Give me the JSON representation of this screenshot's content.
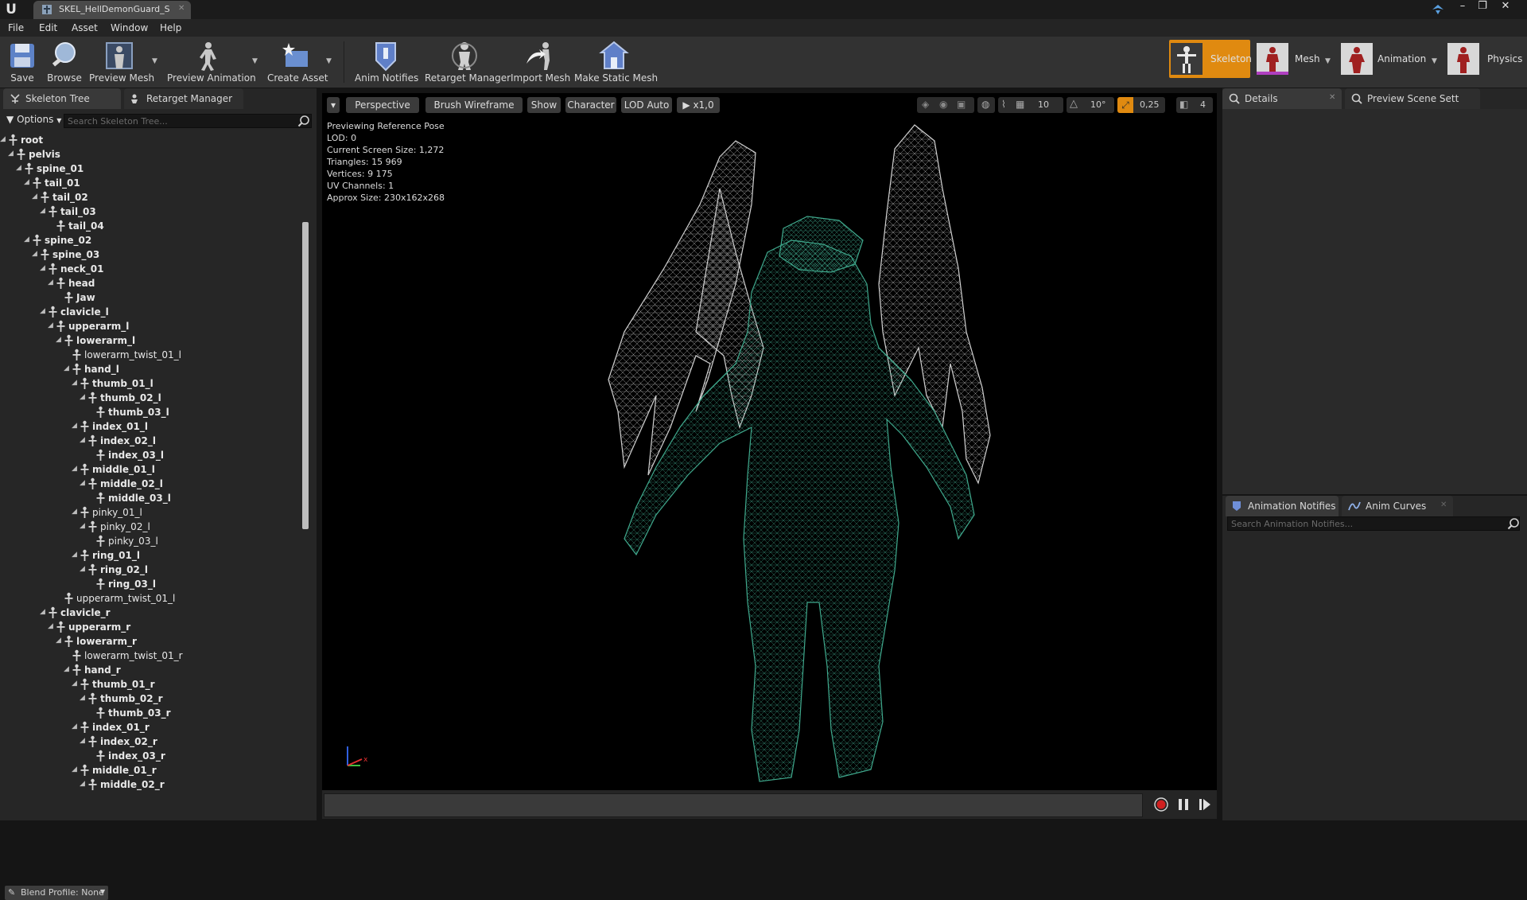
{
  "window": {
    "tab_title": "SKEL_HellDemonGuard_S",
    "minimize": "–",
    "restore": "❐",
    "close": "✕"
  },
  "menu": [
    "File",
    "Edit",
    "Asset",
    "Window",
    "Help"
  ],
  "toolbar": {
    "save": "Save",
    "browse": "Browse",
    "preview_mesh": "Preview Mesh",
    "preview_animation": "Preview Animation",
    "create_asset": "Create Asset",
    "anim_notifies": "Anim Notifies",
    "retarget_manager": "Retarget Manager",
    "import_mesh": "Import Mesh",
    "make_static_mesh": "Make Static Mesh"
  },
  "modes": {
    "skeleton": "Skeleton",
    "mesh": "Mesh",
    "animation": "Animation",
    "physics": "Physics",
    "active": "skeleton",
    "accent_color": "#e08a10"
  },
  "left_panel": {
    "tab_skeleton_tree": "Skeleton Tree",
    "tab_retarget_manager": "Retarget Manager",
    "options": "Options",
    "search_placeholder": "Search Skeleton Tree...",
    "blend_profile": "Blend Profile: None"
  },
  "bones": [
    {
      "name": "root",
      "depth": 0,
      "expanded": true,
      "weighted": true
    },
    {
      "name": "pelvis",
      "depth": 1,
      "expanded": true,
      "weighted": true
    },
    {
      "name": "spine_01",
      "depth": 2,
      "expanded": true,
      "weighted": true
    },
    {
      "name": "tail_01",
      "depth": 3,
      "expanded": true,
      "weighted": true
    },
    {
      "name": "tail_02",
      "depth": 4,
      "expanded": true,
      "weighted": true
    },
    {
      "name": "tail_03",
      "depth": 5,
      "expanded": true,
      "weighted": true
    },
    {
      "name": "tail_04",
      "depth": 6,
      "expanded": false,
      "weighted": true
    },
    {
      "name": "spine_02",
      "depth": 3,
      "expanded": true,
      "weighted": true
    },
    {
      "name": "spine_03",
      "depth": 4,
      "expanded": true,
      "weighted": true
    },
    {
      "name": "neck_01",
      "depth": 5,
      "expanded": true,
      "weighted": true
    },
    {
      "name": "head",
      "depth": 6,
      "expanded": true,
      "weighted": true
    },
    {
      "name": "Jaw",
      "depth": 7,
      "expanded": false,
      "weighted": true
    },
    {
      "name": "clavicle_l",
      "depth": 5,
      "expanded": true,
      "weighted": true
    },
    {
      "name": "upperarm_l",
      "depth": 6,
      "expanded": true,
      "weighted": true
    },
    {
      "name": "lowerarm_l",
      "depth": 7,
      "expanded": true,
      "weighted": true
    },
    {
      "name": "lowerarm_twist_01_l",
      "depth": 8,
      "expanded": false,
      "weighted": false
    },
    {
      "name": "hand_l",
      "depth": 8,
      "expanded": true,
      "weighted": true
    },
    {
      "name": "thumb_01_l",
      "depth": 9,
      "expanded": true,
      "weighted": true
    },
    {
      "name": "thumb_02_l",
      "depth": 10,
      "expanded": true,
      "weighted": true
    },
    {
      "name": "thumb_03_l",
      "depth": 11,
      "expanded": false,
      "weighted": true
    },
    {
      "name": "index_01_l",
      "depth": 9,
      "expanded": true,
      "weighted": true
    },
    {
      "name": "index_02_l",
      "depth": 10,
      "expanded": true,
      "weighted": true
    },
    {
      "name": "index_03_l",
      "depth": 11,
      "expanded": false,
      "weighted": true
    },
    {
      "name": "middle_01_l",
      "depth": 9,
      "expanded": true,
      "weighted": true
    },
    {
      "name": "middle_02_l",
      "depth": 10,
      "expanded": true,
      "weighted": true
    },
    {
      "name": "middle_03_l",
      "depth": 11,
      "expanded": false,
      "weighted": true
    },
    {
      "name": "pinky_01_l",
      "depth": 9,
      "expanded": true,
      "weighted": false
    },
    {
      "name": "pinky_02_l",
      "depth": 10,
      "expanded": true,
      "weighted": false
    },
    {
      "name": "pinky_03_l",
      "depth": 11,
      "expanded": false,
      "weighted": false
    },
    {
      "name": "ring_01_l",
      "depth": 9,
      "expanded": true,
      "weighted": true
    },
    {
      "name": "ring_02_l",
      "depth": 10,
      "expanded": true,
      "weighted": true
    },
    {
      "name": "ring_03_l",
      "depth": 11,
      "expanded": false,
      "weighted": true
    },
    {
      "name": "upperarm_twist_01_l",
      "depth": 7,
      "expanded": false,
      "weighted": false
    },
    {
      "name": "clavicle_r",
      "depth": 5,
      "expanded": true,
      "weighted": true
    },
    {
      "name": "upperarm_r",
      "depth": 6,
      "expanded": true,
      "weighted": true
    },
    {
      "name": "lowerarm_r",
      "depth": 7,
      "expanded": true,
      "weighted": true
    },
    {
      "name": "lowerarm_twist_01_r",
      "depth": 8,
      "expanded": false,
      "weighted": false
    },
    {
      "name": "hand_r",
      "depth": 8,
      "expanded": true,
      "weighted": true
    },
    {
      "name": "thumb_01_r",
      "depth": 9,
      "expanded": true,
      "weighted": true
    },
    {
      "name": "thumb_02_r",
      "depth": 10,
      "expanded": true,
      "weighted": true
    },
    {
      "name": "thumb_03_r",
      "depth": 11,
      "expanded": false,
      "weighted": true
    },
    {
      "name": "index_01_r",
      "depth": 9,
      "expanded": true,
      "weighted": true
    },
    {
      "name": "index_02_r",
      "depth": 10,
      "expanded": true,
      "weighted": true
    },
    {
      "name": "index_03_r",
      "depth": 11,
      "expanded": false,
      "weighted": true
    },
    {
      "name": "middle_01_r",
      "depth": 9,
      "expanded": true,
      "weighted": true
    },
    {
      "name": "middle_02_r",
      "depth": 10,
      "expanded": true,
      "weighted": true
    }
  ],
  "viewport": {
    "perspective": "Perspective",
    "view_mode": "Brush Wireframe",
    "show": "Show",
    "character": "Character",
    "lod": "LOD Auto",
    "play_speed": "x1,0",
    "grid_snap": "10",
    "rotation_snap": "10°",
    "scale_snap": "0,25",
    "camera_speed": "4",
    "stats": [
      "Previewing Reference Pose",
      "LOD: 0",
      "Current Screen Size: 1,272",
      "Triangles: 15 969",
      "Vertices: 9 175",
      "UV Channels: 1",
      "Approx Size: 230x162x268"
    ],
    "mesh_color": "#3fa88c",
    "wing_color": "#d0d0d0"
  },
  "right_panel": {
    "tab_details": "Details",
    "tab_preview_scene": "Preview Scene Sett",
    "tab_animation_notifies": "Animation Notifies",
    "tab_anim_curves": "Anim Curves",
    "notifies_search_placeholder": "Search Animation Notifies..."
  }
}
